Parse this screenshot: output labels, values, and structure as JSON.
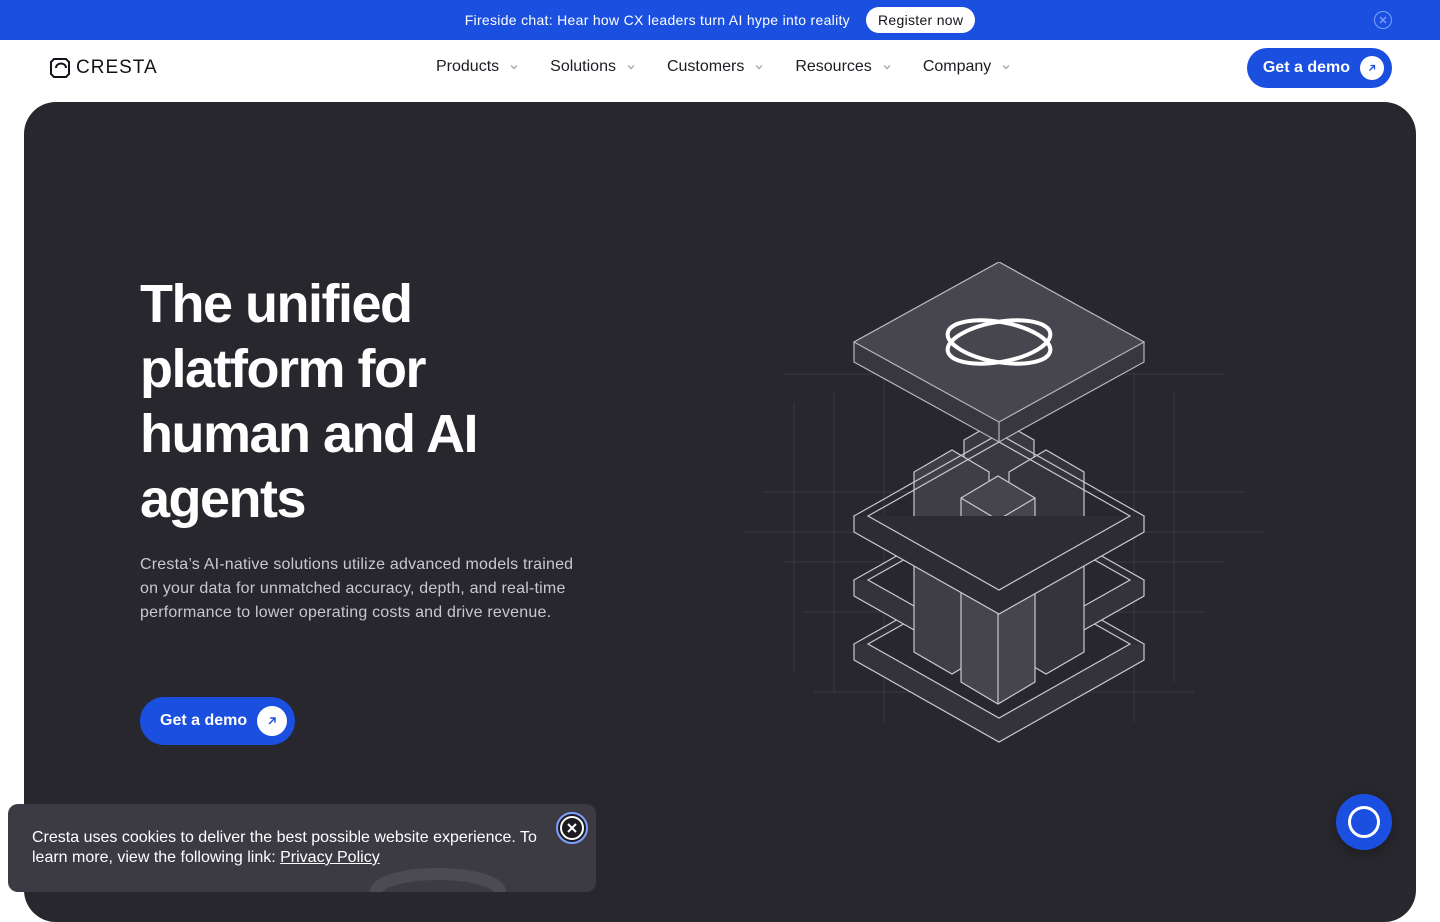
{
  "announcement": {
    "text": "Fireside chat: Hear how CX leaders turn AI hype into reality",
    "button": "Register now"
  },
  "header": {
    "logo": "CRESTA",
    "nav": [
      {
        "label": "Products"
      },
      {
        "label": "Solutions"
      },
      {
        "label": "Customers"
      },
      {
        "label": "Resources"
      },
      {
        "label": "Company"
      }
    ],
    "cta": "Get a demo"
  },
  "hero": {
    "title": "The unified platform for human and AI agents",
    "description": "Cresta’s AI-native solutions utilize advanced models trained on your data for unmatched accuracy, depth, and real-time performance to lower operating costs and drive revenue.",
    "cta": "Get a demo"
  },
  "cookie": {
    "text": "Cresta uses cookies to deliver the best possible website experience. To learn more, view the following link: ",
    "link": "Privacy Policy"
  },
  "colors": {
    "accent": "#1a4fe0",
    "hero_bg": "#28272d",
    "cookie_bg": "#3c3b44"
  },
  "icons": {
    "announce_close": "close-icon",
    "nav_chevron": "chevron-down-icon",
    "cta_arrow": "arrow-up-right-icon",
    "cookie_close": "close-icon",
    "chat": "chat-icon"
  }
}
